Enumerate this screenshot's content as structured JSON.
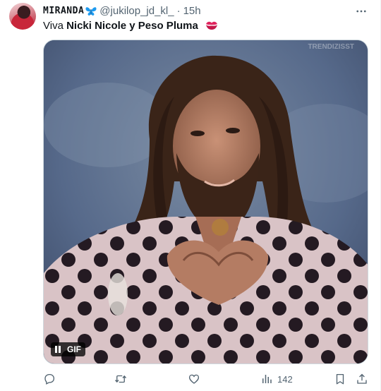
{
  "tweet": {
    "display_name": "MIRANDA",
    "handle": "@jukilop_jd_kl_",
    "separator": "·",
    "timestamp": "15h",
    "text_prefix": "Viva ",
    "text_bold": "Nicki Nicole y Peso Pluma",
    "media": {
      "type": "gif",
      "badge_label": "GIF",
      "watermark": "TRENDIZISST"
    },
    "actions": {
      "reply_count": "",
      "retweet_count": "",
      "like_count": "",
      "views_count": "142"
    }
  },
  "icons": {
    "avatar": "avatar",
    "name_emoji": "butterfly-icon",
    "text_emoji": "kiss-mark-icon",
    "more": "more-icon",
    "reply": "reply-icon",
    "retweet": "retweet-icon",
    "like": "heart-icon",
    "views": "views-icon",
    "bookmark": "bookmark-icon",
    "share": "share-icon",
    "pause": "pause-icon"
  },
  "colors": {
    "text_primary": "#0f1419",
    "text_secondary": "#536471",
    "butterfly": "#1d9bf0",
    "kiss": "#e0245e"
  }
}
